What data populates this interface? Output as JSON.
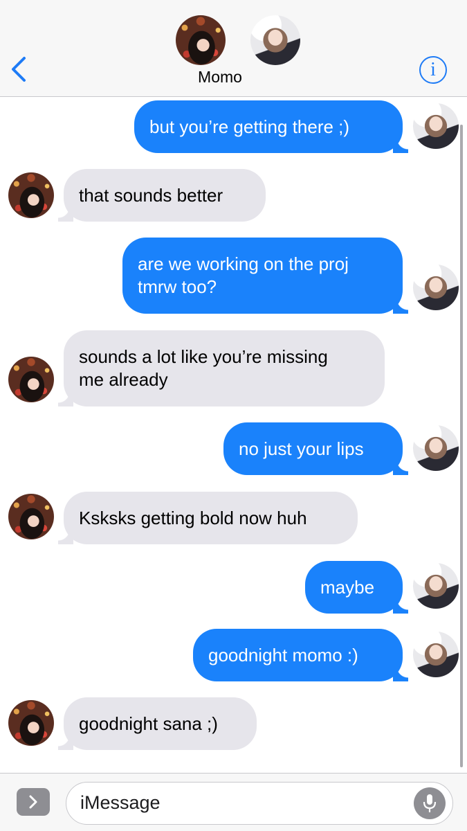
{
  "header": {
    "contact_name": "Momo",
    "accent_color": "#1e7bf6",
    "info_glyph": "i"
  },
  "thread": {
    "messages": [
      {
        "direction": "sent",
        "text": "but you’re getting there ;)"
      },
      {
        "direction": "received",
        "text": "that sounds better"
      },
      {
        "direction": "sent",
        "text": "are we working on the proj\ntmrw too?"
      },
      {
        "direction": "received",
        "text": "sounds a lot like you’re missing\nme already"
      },
      {
        "direction": "sent",
        "text": "no just your lips"
      },
      {
        "direction": "received",
        "text": "Ksksks getting bold now huh"
      },
      {
        "direction": "sent",
        "text": "maybe"
      },
      {
        "direction": "sent",
        "text": "goodnight momo :)"
      },
      {
        "direction": "received",
        "text": "goodnight sana ;)"
      }
    ],
    "colors": {
      "sent_bubble": "#1a82fb",
      "received_bubble": "#e6e5eb"
    }
  },
  "compose": {
    "placeholder": "iMessage"
  },
  "icons": {
    "back": "chevron-left-icon",
    "info": "info-icon",
    "apps": "chevron-right-icon",
    "mic": "microphone-icon"
  }
}
